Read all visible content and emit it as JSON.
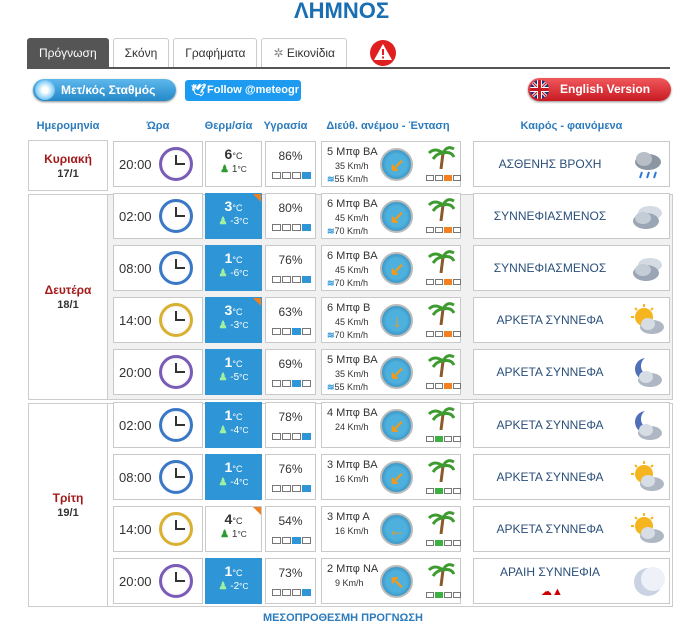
{
  "page": {
    "title": "ΛΗΜΝΟΣ"
  },
  "tabs": [
    {
      "label": "Πρόγνωση",
      "active": true
    },
    {
      "label": "Σκόνη",
      "active": false
    },
    {
      "label": "Γραφήματα",
      "active": false
    },
    {
      "label": "Εικονίδια",
      "active": false
    }
  ],
  "buttons": {
    "station": "Μετ/κός Σταθμός",
    "twitter": "Follow @meteogr",
    "english": "English Version"
  },
  "headers": {
    "date": "Ημερομηνία",
    "time": "Ώρα",
    "temp": "Θερμ/σία",
    "humidity": "Υγρασία",
    "wind": "Διεύθ. ανέμου - Ένταση",
    "weather": "Καιρός - φαινόμενα"
  },
  "days": [
    {
      "name": "Κυριακή",
      "date": "17/1"
    },
    {
      "name": "Δευτέρα",
      "date": "18/1"
    },
    {
      "name": "Τρίτη",
      "date": "19/1"
    }
  ],
  "rows": [
    {
      "time": "20:00",
      "temp": "6",
      "feels": "1",
      "temp_unit": "°C",
      "hum": "86%",
      "hum_level": 3,
      "wind": "5 Μπφ ΒΑ",
      "kmh": "35 Km/h",
      "gust": "55 Km/h",
      "wind_level": 2,
      "weather": "ΑΣΘΕΝΗΣ ΒΡΟΧΗ",
      "weather_icon": "rain-cloud-icon"
    },
    {
      "time": "02:00",
      "temp": "3",
      "feels": "-3",
      "temp_unit": "°C",
      "hum": "80%",
      "hum_level": 3,
      "wind": "6 Μπφ ΒΑ",
      "kmh": "45 Km/h",
      "gust": "70 Km/h",
      "wind_level": 2,
      "weather": "ΣΥΝΝΕΦΙΑΣΜΕΝΟΣ",
      "weather_icon": "cloudy-icon"
    },
    {
      "time": "08:00",
      "temp": "1",
      "feels": "-6",
      "temp_unit": "°C",
      "hum": "76%",
      "hum_level": 3,
      "wind": "6 Μπφ ΒΑ",
      "kmh": "45 Km/h",
      "gust": "70 Km/h",
      "wind_level": 2,
      "weather": "ΣΥΝΝΕΦΙΑΣΜΕΝΟΣ",
      "weather_icon": "cloudy-icon"
    },
    {
      "time": "14:00",
      "temp": "3",
      "feels": "-3",
      "temp_unit": "°C",
      "hum": "63%",
      "hum_level": 2,
      "wind": "6 Μπφ Β",
      "kmh": "45 Km/h",
      "gust": "70 Km/h",
      "wind_level": 2,
      "weather": "ΑΡΚΕΤΑ ΣΥΝΝΕΦΑ",
      "weather_icon": "sun-cloud-icon"
    },
    {
      "time": "20:00",
      "temp": "1",
      "feels": "-5",
      "temp_unit": "°C",
      "hum": "69%",
      "hum_level": 2,
      "wind": "5 Μπφ ΒΑ",
      "kmh": "35 Km/h",
      "gust": "55 Km/h",
      "wind_level": 2,
      "weather": "ΑΡΚΕΤΑ ΣΥΝΝΕΦΑ",
      "weather_icon": "moon-cloud-icon"
    },
    {
      "time": "02:00",
      "temp": "1",
      "feels": "-4",
      "temp_unit": "°C",
      "hum": "78%",
      "hum_level": 3,
      "wind": "4 Μπφ ΒΑ",
      "kmh": "24 Km/h",
      "gust": "",
      "wind_level": 1,
      "weather": "ΑΡΚΕΤΑ ΣΥΝΝΕΦΑ",
      "weather_icon": "moon-cloud-icon"
    },
    {
      "time": "08:00",
      "temp": "1",
      "feels": "-4",
      "temp_unit": "°C",
      "hum": "76%",
      "hum_level": 3,
      "wind": "3 Μπφ ΒΑ",
      "kmh": "16 Km/h",
      "gust": "",
      "wind_level": 1,
      "weather": "ΑΡΚΕΤΑ ΣΥΝΝΕΦΑ",
      "weather_icon": "sun-cloud-icon"
    },
    {
      "time": "14:00",
      "temp": "4",
      "feels": "1",
      "temp_unit": "°C",
      "hum": "54%",
      "hum_level": 2,
      "wind": "3 Μπφ Α",
      "kmh": "16 Km/h",
      "gust": "",
      "wind_level": 1,
      "weather": "ΑΡΚΕΤΑ ΣΥΝΝΕΦΑ",
      "weather_icon": "sun-cloud-icon"
    },
    {
      "time": "20:00",
      "temp": "1",
      "feels": "-2",
      "temp_unit": "°C",
      "hum": "73%",
      "hum_level": 3,
      "wind": "2 Μπφ ΝΑ",
      "kmh": "9 Km/h",
      "gust": "",
      "wind_level": 1,
      "weather": "ΑΡΑΙΗ ΣΥΝΝΕΦΙΑ",
      "weather_icon": "moon-icon"
    }
  ],
  "footer": "ΜΕΣΟΠΡΟΘΕΣΜΗ ΠΡΟΓΝΩΣΗ"
}
